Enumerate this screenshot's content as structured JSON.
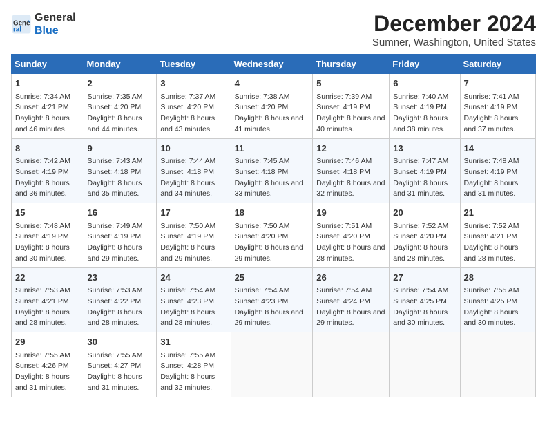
{
  "header": {
    "logo_line1": "General",
    "logo_line2": "Blue",
    "month": "December 2024",
    "location": "Sumner, Washington, United States"
  },
  "days_of_week": [
    "Sunday",
    "Monday",
    "Tuesday",
    "Wednesday",
    "Thursday",
    "Friday",
    "Saturday"
  ],
  "weeks": [
    [
      {
        "num": "1",
        "sunrise": "Sunrise: 7:34 AM",
        "sunset": "Sunset: 4:21 PM",
        "daylight": "Daylight: 8 hours and 46 minutes."
      },
      {
        "num": "2",
        "sunrise": "Sunrise: 7:35 AM",
        "sunset": "Sunset: 4:20 PM",
        "daylight": "Daylight: 8 hours and 44 minutes."
      },
      {
        "num": "3",
        "sunrise": "Sunrise: 7:37 AM",
        "sunset": "Sunset: 4:20 PM",
        "daylight": "Daylight: 8 hours and 43 minutes."
      },
      {
        "num": "4",
        "sunrise": "Sunrise: 7:38 AM",
        "sunset": "Sunset: 4:20 PM",
        "daylight": "Daylight: 8 hours and 41 minutes."
      },
      {
        "num": "5",
        "sunrise": "Sunrise: 7:39 AM",
        "sunset": "Sunset: 4:19 PM",
        "daylight": "Daylight: 8 hours and 40 minutes."
      },
      {
        "num": "6",
        "sunrise": "Sunrise: 7:40 AM",
        "sunset": "Sunset: 4:19 PM",
        "daylight": "Daylight: 8 hours and 38 minutes."
      },
      {
        "num": "7",
        "sunrise": "Sunrise: 7:41 AM",
        "sunset": "Sunset: 4:19 PM",
        "daylight": "Daylight: 8 hours and 37 minutes."
      }
    ],
    [
      {
        "num": "8",
        "sunrise": "Sunrise: 7:42 AM",
        "sunset": "Sunset: 4:19 PM",
        "daylight": "Daylight: 8 hours and 36 minutes."
      },
      {
        "num": "9",
        "sunrise": "Sunrise: 7:43 AM",
        "sunset": "Sunset: 4:18 PM",
        "daylight": "Daylight: 8 hours and 35 minutes."
      },
      {
        "num": "10",
        "sunrise": "Sunrise: 7:44 AM",
        "sunset": "Sunset: 4:18 PM",
        "daylight": "Daylight: 8 hours and 34 minutes."
      },
      {
        "num": "11",
        "sunrise": "Sunrise: 7:45 AM",
        "sunset": "Sunset: 4:18 PM",
        "daylight": "Daylight: 8 hours and 33 minutes."
      },
      {
        "num": "12",
        "sunrise": "Sunrise: 7:46 AM",
        "sunset": "Sunset: 4:18 PM",
        "daylight": "Daylight: 8 hours and 32 minutes."
      },
      {
        "num": "13",
        "sunrise": "Sunrise: 7:47 AM",
        "sunset": "Sunset: 4:19 PM",
        "daylight": "Daylight: 8 hours and 31 minutes."
      },
      {
        "num": "14",
        "sunrise": "Sunrise: 7:48 AM",
        "sunset": "Sunset: 4:19 PM",
        "daylight": "Daylight: 8 hours and 31 minutes."
      }
    ],
    [
      {
        "num": "15",
        "sunrise": "Sunrise: 7:48 AM",
        "sunset": "Sunset: 4:19 PM",
        "daylight": "Daylight: 8 hours and 30 minutes."
      },
      {
        "num": "16",
        "sunrise": "Sunrise: 7:49 AM",
        "sunset": "Sunset: 4:19 PM",
        "daylight": "Daylight: 8 hours and 29 minutes."
      },
      {
        "num": "17",
        "sunrise": "Sunrise: 7:50 AM",
        "sunset": "Sunset: 4:19 PM",
        "daylight": "Daylight: 8 hours and 29 minutes."
      },
      {
        "num": "18",
        "sunrise": "Sunrise: 7:50 AM",
        "sunset": "Sunset: 4:20 PM",
        "daylight": "Daylight: 8 hours and 29 minutes."
      },
      {
        "num": "19",
        "sunrise": "Sunrise: 7:51 AM",
        "sunset": "Sunset: 4:20 PM",
        "daylight": "Daylight: 8 hours and 28 minutes."
      },
      {
        "num": "20",
        "sunrise": "Sunrise: 7:52 AM",
        "sunset": "Sunset: 4:20 PM",
        "daylight": "Daylight: 8 hours and 28 minutes."
      },
      {
        "num": "21",
        "sunrise": "Sunrise: 7:52 AM",
        "sunset": "Sunset: 4:21 PM",
        "daylight": "Daylight: 8 hours and 28 minutes."
      }
    ],
    [
      {
        "num": "22",
        "sunrise": "Sunrise: 7:53 AM",
        "sunset": "Sunset: 4:21 PM",
        "daylight": "Daylight: 8 hours and 28 minutes."
      },
      {
        "num": "23",
        "sunrise": "Sunrise: 7:53 AM",
        "sunset": "Sunset: 4:22 PM",
        "daylight": "Daylight: 8 hours and 28 minutes."
      },
      {
        "num": "24",
        "sunrise": "Sunrise: 7:54 AM",
        "sunset": "Sunset: 4:23 PM",
        "daylight": "Daylight: 8 hours and 28 minutes."
      },
      {
        "num": "25",
        "sunrise": "Sunrise: 7:54 AM",
        "sunset": "Sunset: 4:23 PM",
        "daylight": "Daylight: 8 hours and 29 minutes."
      },
      {
        "num": "26",
        "sunrise": "Sunrise: 7:54 AM",
        "sunset": "Sunset: 4:24 PM",
        "daylight": "Daylight: 8 hours and 29 minutes."
      },
      {
        "num": "27",
        "sunrise": "Sunrise: 7:54 AM",
        "sunset": "Sunset: 4:25 PM",
        "daylight": "Daylight: 8 hours and 30 minutes."
      },
      {
        "num": "28",
        "sunrise": "Sunrise: 7:55 AM",
        "sunset": "Sunset: 4:25 PM",
        "daylight": "Daylight: 8 hours and 30 minutes."
      }
    ],
    [
      {
        "num": "29",
        "sunrise": "Sunrise: 7:55 AM",
        "sunset": "Sunset: 4:26 PM",
        "daylight": "Daylight: 8 hours and 31 minutes."
      },
      {
        "num": "30",
        "sunrise": "Sunrise: 7:55 AM",
        "sunset": "Sunset: 4:27 PM",
        "daylight": "Daylight: 8 hours and 31 minutes."
      },
      {
        "num": "31",
        "sunrise": "Sunrise: 7:55 AM",
        "sunset": "Sunset: 4:28 PM",
        "daylight": "Daylight: 8 hours and 32 minutes."
      },
      null,
      null,
      null,
      null
    ]
  ]
}
